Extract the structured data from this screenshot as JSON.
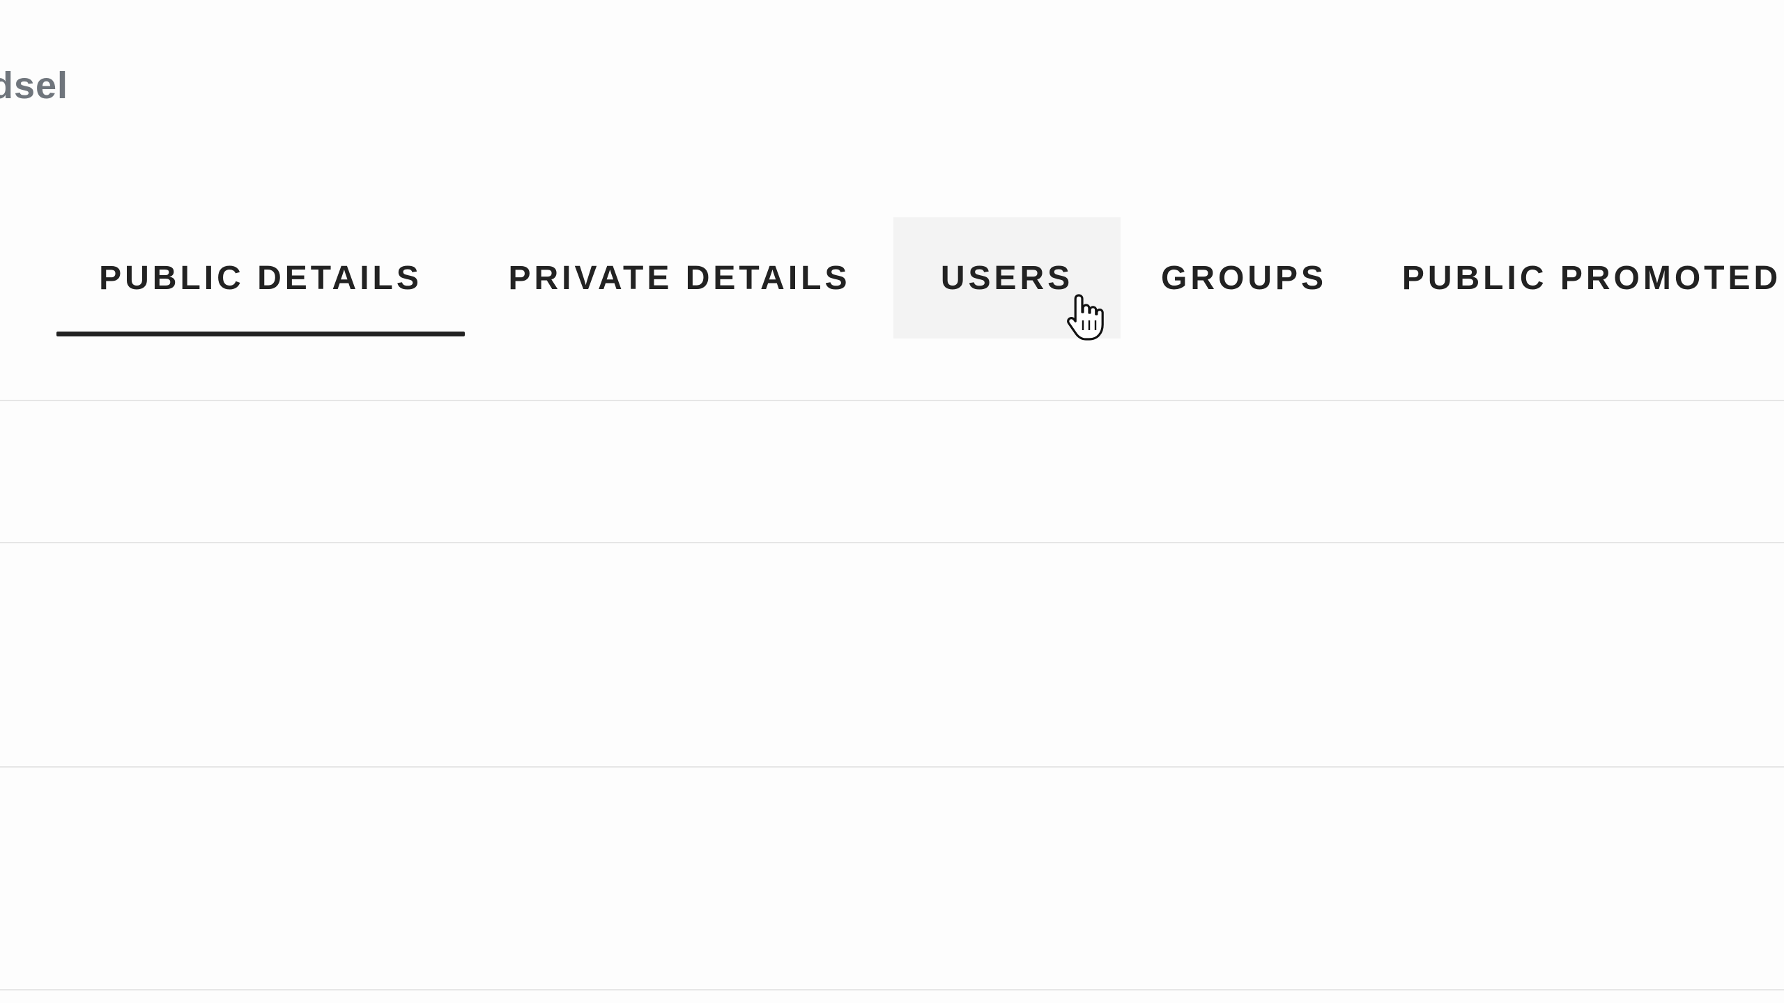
{
  "header": {
    "title": "dsel"
  },
  "tabs": [
    {
      "label": "PUBLIC DETAILS",
      "active": true
    },
    {
      "label": "PRIVATE DETAILS",
      "active": false
    },
    {
      "label": "USERS",
      "active": false,
      "hovered": true
    },
    {
      "label": "GROUPS",
      "active": false
    },
    {
      "label": "PUBLIC PROMOTED",
      "active": false
    }
  ],
  "colors": {
    "title": "#6f757c",
    "tab_text": "#222222",
    "active_underline": "#222222",
    "hover_background": "#f3f3f3",
    "divider": "#e6e6e6",
    "background": "#fdfdfd"
  },
  "icons": {
    "cursor": "hand-pointer-cursor-icon"
  }
}
